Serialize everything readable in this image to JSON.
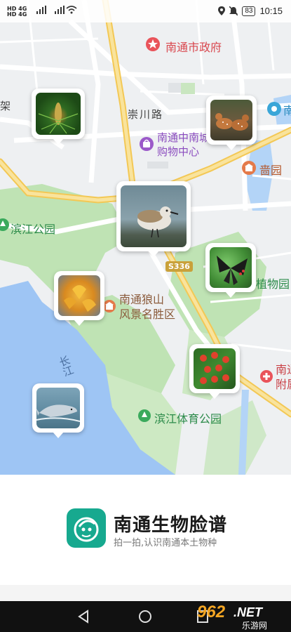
{
  "status_bar": {
    "sim1": "HD",
    "sim2": "HD",
    "net1": "4G",
    "net2": "4G",
    "battery": "83",
    "time": "10:15"
  },
  "map": {
    "labels": {
      "city_gov": "南通市政府",
      "chongchuan_road": "崇川路",
      "mall_line1": "南通中南城",
      "mall_line2": "购物中心",
      "garden": "啬园",
      "binjiang_park": "滨江公园",
      "road_s336": "S336",
      "botanical": "植物园",
      "langshan_line1": "南通狼山",
      "langshan_line2": "风景名胜区",
      "yangtze": "长江",
      "sports_park": "滨江体育公园",
      "hospital_line1": "南通",
      "hospital_line2": "附属",
      "left_edge": "架",
      "right_edge": "南"
    },
    "pins": [
      {
        "species": "pine-plant"
      },
      {
        "species": "deer"
      },
      {
        "species": "sandpiper-bird"
      },
      {
        "species": "swallowtail-butterfly"
      },
      {
        "species": "ginkgo-leaves"
      },
      {
        "species": "red-berries-yew"
      },
      {
        "species": "finless-porpoise"
      }
    ]
  },
  "app": {
    "title": "南通生物脸谱",
    "subtitle": "拍一拍,认识南通本土物种"
  },
  "watermark": {
    "brand": "962",
    "suffix": ".NET",
    "sub": "乐游网"
  },
  "colors": {
    "accent": "#17a98f",
    "water": "#9ec5f4",
    "park": "#bfe3b4",
    "road_yellow": "#f6d776"
  }
}
